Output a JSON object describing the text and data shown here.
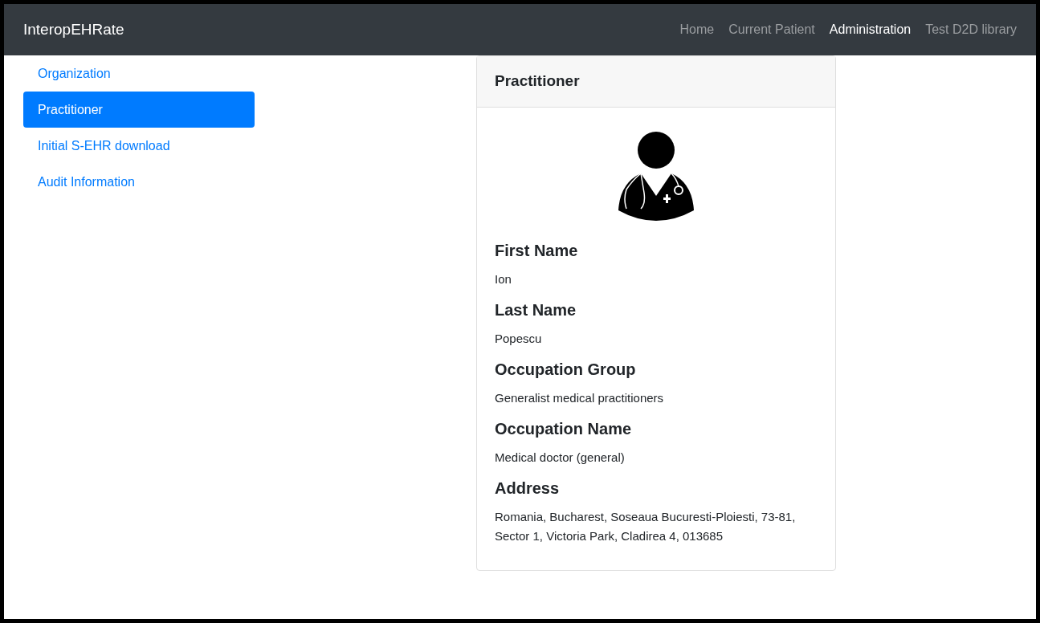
{
  "navbar": {
    "brand": "InteropEHRate",
    "links": [
      {
        "label": "Home",
        "selected": false
      },
      {
        "label": "Current Patient",
        "selected": false
      },
      {
        "label": "Administration",
        "selected": true
      },
      {
        "label": "Test D2D library",
        "selected": false
      }
    ]
  },
  "sidebar": {
    "items": [
      {
        "label": "Organization",
        "selected": false
      },
      {
        "label": "Practitioner",
        "selected": true
      },
      {
        "label": "Initial S-EHR download",
        "selected": false
      },
      {
        "label": "Audit Information",
        "selected": false
      }
    ]
  },
  "card": {
    "title": "Practitioner",
    "fields": [
      {
        "label": "First Name",
        "value": "Ion"
      },
      {
        "label": "Last Name",
        "value": "Popescu"
      },
      {
        "label": "Occupation Group",
        "value": "Generalist medical practitioners"
      },
      {
        "label": "Occupation Name",
        "value": "Medical doctor (general)"
      },
      {
        "label": "Address",
        "value": "Romania, Bucharest, Soseaua Bucuresti-Ploiesti, 73-81, Sector 1, Victoria Park, Cladirea 4, 013685"
      }
    ]
  }
}
